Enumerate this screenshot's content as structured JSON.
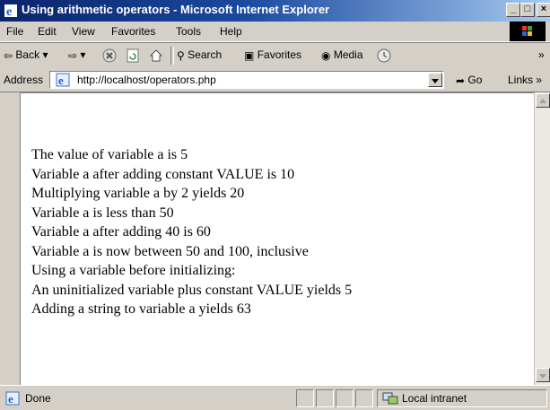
{
  "window": {
    "title": "Using arithmetic operators - Microsoft Internet Explorer",
    "buttons": {
      "minimize": "_",
      "maximize": "□",
      "close": "×"
    }
  },
  "menu": [
    "File",
    "Edit",
    "View",
    "Favorites",
    "Tools",
    "Help"
  ],
  "toolbar": {
    "back": "Back",
    "search": "Search",
    "favorites": "Favorites",
    "media": "Media",
    "chevron": "»"
  },
  "address": {
    "label": "Address",
    "url": "http://localhost/operators.php",
    "go": "Go",
    "links": "Links »"
  },
  "content": {
    "lines": [
      "The value of variable a is 5",
      "Variable a after adding constant VALUE is 10",
      "Multiplying variable a by 2 yields 20",
      "Variable a is less than 50",
      "Variable a after adding 40 is 60",
      "Variable a is now between 50 and 100, inclusive",
      "Using a variable before initializing:",
      "An uninitialized variable plus constant VALUE yields 5",
      "Adding a string to variable a yields 63"
    ]
  },
  "status": {
    "text": "Done",
    "zone": "Local intranet"
  },
  "colors": {
    "titlebar_start": "#0a246a",
    "titlebar_end": "#a6caf0",
    "chrome": "#d4d0c8"
  }
}
